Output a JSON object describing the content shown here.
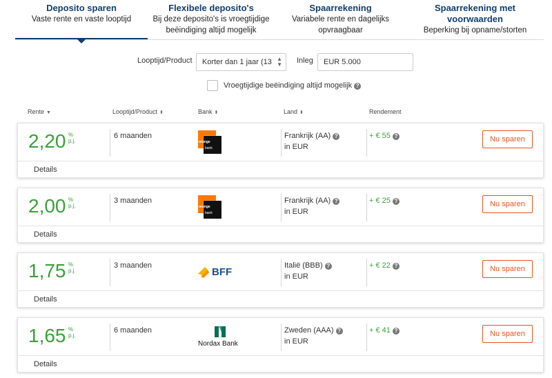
{
  "tabs": [
    {
      "title": "Deposito sparen",
      "sub": "Vaste rente en vaste looptijd",
      "sub2": ""
    },
    {
      "title": "Flexibele deposito's",
      "sub": "Bij deze deposito's is vroegtijdige",
      "sub2": "beëindiging altijd mogelijk"
    },
    {
      "title": "Spaarrekening",
      "sub": "Variabele rente en dagelijks",
      "sub2": "opvraagbaar"
    },
    {
      "title": "Spaarrekening met voorwaarden",
      "sub": "Beperking bij opname/storten",
      "sub2": ""
    }
  ],
  "filters": {
    "product_label": "Looptijd/Product",
    "product_value": "Korter dan 1 jaar (13",
    "amount_label": "Inleg",
    "amount_value": "EUR 5.000",
    "early_label": "Vroegtijdige beëindiging altijd mogelijk"
  },
  "columns": {
    "rate": "Rente",
    "period": "Looptijd/Product",
    "bank": "Bank",
    "land": "Land",
    "yield": "Rendement"
  },
  "rows": [
    {
      "rate": "2,20",
      "unit1": "%",
      "unit2": "p.j.",
      "period": "6 maanden",
      "bank_logo": "orange-bank-logo",
      "land": "Frankrijk (AA)",
      "currency": "in EUR",
      "yield": "+ € 55",
      "button": "Nu sparen",
      "details": "Details"
    },
    {
      "rate": "2,00",
      "unit1": "%",
      "unit2": "p.j.",
      "period": "3 maanden",
      "bank_logo": "orange-bank-logo",
      "land": "Frankrijk (AA)",
      "currency": "in EUR",
      "yield": "+ € 25",
      "button": "Nu sparen",
      "details": "Details"
    },
    {
      "rate": "1,75",
      "unit1": "%",
      "unit2": "p.j.",
      "period": "3 maanden",
      "bank_logo": "bff-logo",
      "land": "Italië (BBB)",
      "currency": "in EUR",
      "yield": "+ € 22",
      "button": "Nu sparen",
      "details": "Details"
    },
    {
      "rate": "1,65",
      "unit1": "%",
      "unit2": "p.j.",
      "period": "6 maanden",
      "bank_logo": "nordax-bank-logo",
      "land": "Zweden (AAA)",
      "currency": "in EUR",
      "yield": "+ € 41",
      "button": "Nu sparen",
      "details": "Details"
    }
  ],
  "logos": {
    "orange_line1": "orange",
    "orange_line2": "bank",
    "bff": "BFF",
    "nordax": "Nordax Bank"
  },
  "colors": {
    "accent": "#0f3f6f",
    "rate_green": "#3aa13a",
    "button_orange": "#e8541e",
    "orange_brand": "#ff7900"
  }
}
